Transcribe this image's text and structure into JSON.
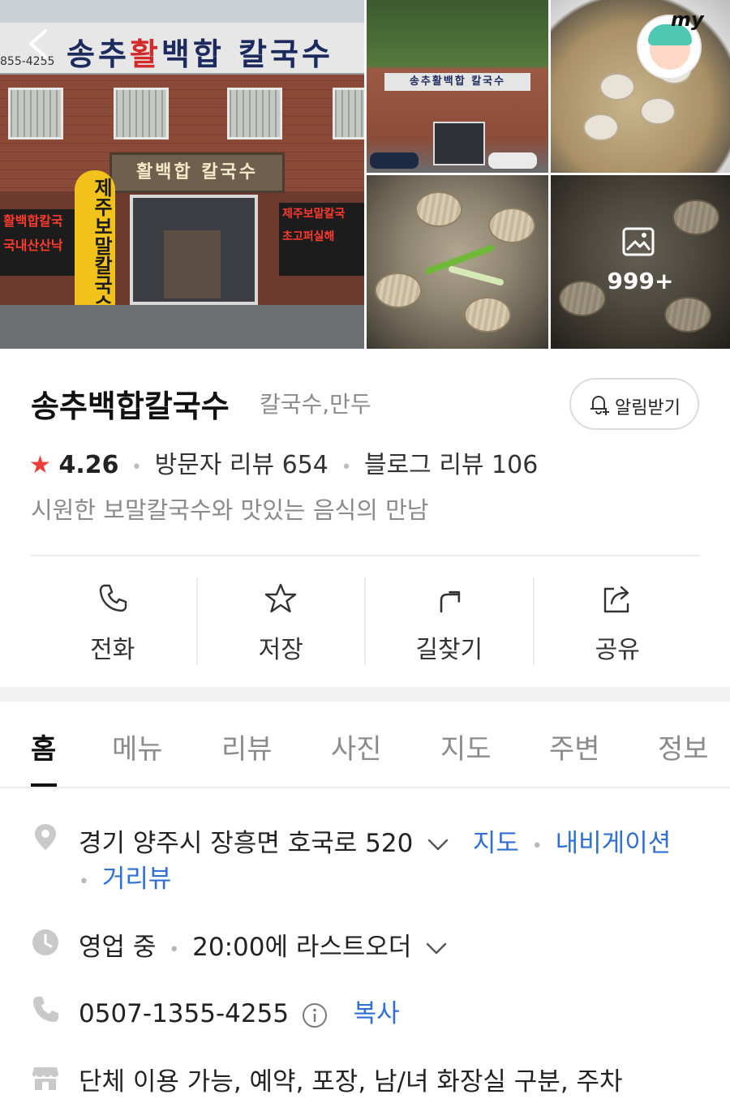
{
  "gallery": {
    "main_sign": "송추활백합 칼국수",
    "main_sign_hl": "활",
    "main_sign_phone": "855-4255",
    "door_sign": "활백합 칼국수",
    "balloon": "제주보말칼국수",
    "banner_left": "활백합칼국\n국내산산낙",
    "banner_right": "제주보말칼국\n초고퍼실해",
    "small_sign": "송추활백합 칼국수",
    "more_count": "999+",
    "avatar_label": "my"
  },
  "place": {
    "name": "송추백합칼국수",
    "category": "칼국수,만두",
    "alarm_label": "알림받기",
    "rating": "4.26",
    "visitor_reviews": "방문자 리뷰 654",
    "blog_reviews": "블로그 리뷰 106",
    "tagline": "시원한 보말칼국수와 맛있는 음식의 만남"
  },
  "actions": {
    "call": "전화",
    "save": "저장",
    "directions": "길찾기",
    "share": "공유"
  },
  "tabs": [
    "홈",
    "메뉴",
    "리뷰",
    "사진",
    "지도",
    "주변",
    "정보"
  ],
  "active_tab": "홈",
  "info": {
    "address": "경기 양주시 장흥면 호국로 520",
    "map_link": "지도",
    "navi_link": "내비게이션",
    "street_view": "거리뷰",
    "status": "영업 중",
    "last_order": "20:00에 라스트오더",
    "phone": "0507-1355-4255",
    "copy": "복사",
    "amenities": "단체 이용 가능, 예약, 포장, 남/녀 화장실 구분, 주차"
  },
  "colors": {
    "accent_star": "#f03c3c",
    "link": "#2f6fd6",
    "muted": "#8a8a8a"
  },
  "icons": [
    "back-arrow-icon",
    "image-icon",
    "bell-plus-icon",
    "phone-icon",
    "star-icon",
    "directions-icon",
    "share-icon",
    "map-pin-icon",
    "clock-icon",
    "info-icon",
    "store-icon",
    "chevron-down-icon"
  ]
}
